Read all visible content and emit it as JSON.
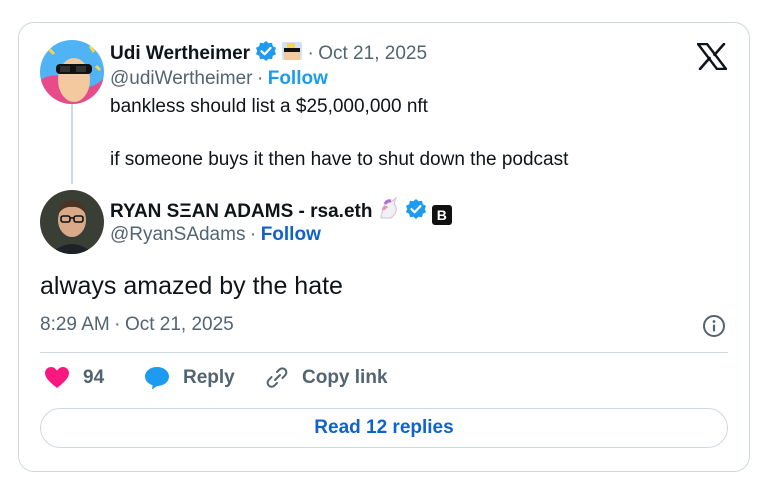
{
  "quoted": {
    "name": "Udi Wertheimer",
    "separator": "·",
    "date": "Oct 21, 2025",
    "handle": "@udiWertheimer",
    "follow": "Follow",
    "line1": "bankless should list a $25,000,000 nft",
    "line2": "if someone buys it then have to shut down the podcast",
    "avatar_icon": "cartoon-avatar-sunglasses",
    "badge_icons": [
      "verified-badge-icon",
      "sunglasses-emoji-icon"
    ]
  },
  "main": {
    "name": "RYAN SΞAN ADAMS - rsa.eth",
    "handle": "@RyanSAdams",
    "separator": "·",
    "follow": "Follow",
    "text": "always amazed by the hate",
    "time": "8:29 AM",
    "date": "Oct 21, 2025",
    "badge_icons": [
      "unicorn-emoji-icon",
      "verified-badge-icon",
      "bankless-logo-icon"
    ],
    "bankless_badge_letter": "B"
  },
  "actions": {
    "likes": "94",
    "reply": "Reply",
    "copy_link": "Copy link"
  },
  "read_replies": "Read 12 replies",
  "colors": {
    "accent": "#1d9bf0",
    "link": "#0f63c9",
    "like": "#f91880",
    "muted": "#536471",
    "border": "#cfd9de"
  }
}
